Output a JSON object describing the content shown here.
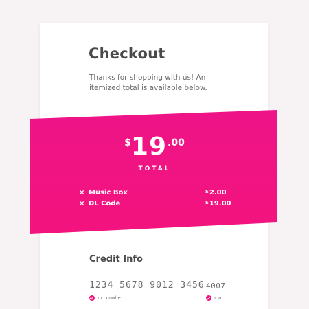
{
  "checkout": {
    "title": "Checkout",
    "intro": "Thanks for shopping with us!  An itemized total is available below."
  },
  "total": {
    "currency": "$",
    "whole": "19",
    "cents": ".00",
    "label": "TOTAL"
  },
  "items": [
    {
      "remove_icon": "×",
      "name": "Music Box",
      "currency": "$",
      "price": "2.00"
    },
    {
      "remove_icon": "×",
      "name": "DL Code",
      "currency": "$",
      "price": "19.00"
    }
  ],
  "credit": {
    "title": "Credit Info",
    "card_number": "1234 5678 9012 3456",
    "card_number_label": "cc number",
    "cvc": "4007",
    "cvc_label": "cvc"
  },
  "colors": {
    "accent": "#f0147f",
    "background": "#f7f3f5"
  },
  "icons": {
    "remove": "remove-x-icon",
    "valid": "check-circle-icon"
  }
}
